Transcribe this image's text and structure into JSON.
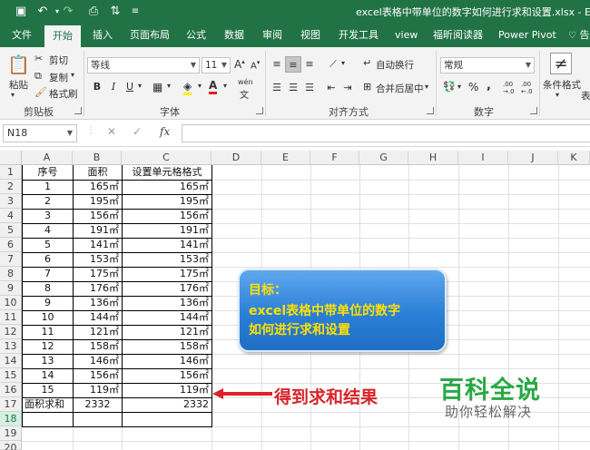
{
  "window": {
    "title": "excel表格中带单位的数字如何进行求和设置.xlsx - E",
    "qa_icons": [
      "save-icon",
      "undo-icon",
      "undo-dropdown-icon",
      "redo-icon",
      "print-preview-icon",
      "sort-icon",
      "customize-icon"
    ]
  },
  "tabs": [
    {
      "label": "文件"
    },
    {
      "label": "开始"
    },
    {
      "label": "插入"
    },
    {
      "label": "页面布局"
    },
    {
      "label": "公式"
    },
    {
      "label": "数据"
    },
    {
      "label": "审阅"
    },
    {
      "label": "视图"
    },
    {
      "label": "开发工具"
    },
    {
      "label": "view"
    },
    {
      "label": "福昕阅读器"
    },
    {
      "label": "Power Pivot"
    },
    {
      "label": "告"
    }
  ],
  "ribbon": {
    "clipboard": {
      "paste": "粘贴",
      "cut": "剪切",
      "copy": "复制",
      "format_painter": "格式刷",
      "label": "剪贴板"
    },
    "font": {
      "name": "等线",
      "size": "11",
      "bold": "B",
      "italic": "I",
      "underline": "U",
      "label": "字体",
      "grow": "A",
      "shrink": "A",
      "phonetic": "wén"
    },
    "alignment": {
      "wrap": "自动换行",
      "merge": "合并后居中",
      "label": "对齐方式"
    },
    "number": {
      "format": "常规",
      "percent": "%",
      "comma": ",",
      "label": "数字",
      "inc_dec": ".00 →.0",
      "dec_dec": ".00 ←.0"
    },
    "styles": {
      "conditional": "条件格式",
      "table": "表"
    }
  },
  "formula_bar": {
    "name_box": "N18",
    "cancel": "✕",
    "enter": "✓",
    "fx": "fx",
    "value": ""
  },
  "columns": [
    "A",
    "B",
    "C",
    "D",
    "E",
    "F",
    "G",
    "H",
    "I",
    "J",
    "K"
  ],
  "rows": [
    "1",
    "2",
    "3",
    "4",
    "5",
    "6",
    "7",
    "8",
    "9",
    "10",
    "11",
    "12",
    "13",
    "14",
    "15",
    "16",
    "17",
    "18",
    "19",
    "20"
  ],
  "table": {
    "headers": [
      "序号",
      "面积",
      "设置单元格格式"
    ],
    "data": [
      [
        "1",
        "165㎡",
        "165㎡"
      ],
      [
        "2",
        "195㎡",
        "195㎡"
      ],
      [
        "3",
        "156㎡",
        "156㎡"
      ],
      [
        "4",
        "191㎡",
        "191㎡"
      ],
      [
        "5",
        "141㎡",
        "141㎡"
      ],
      [
        "6",
        "153㎡",
        "153㎡"
      ],
      [
        "7",
        "175㎡",
        "175㎡"
      ],
      [
        "8",
        "176㎡",
        "176㎡"
      ],
      [
        "9",
        "136㎡",
        "136㎡"
      ],
      [
        "10",
        "144㎡",
        "144㎡"
      ],
      [
        "11",
        "121㎡",
        "121㎡"
      ],
      [
        "12",
        "158㎡",
        "158㎡"
      ],
      [
        "13",
        "146㎡",
        "146㎡"
      ],
      [
        "14",
        "156㎡",
        "156㎡"
      ],
      [
        "15",
        "119㎡",
        "119㎡"
      ]
    ],
    "total": [
      "面积求和",
      "2332",
      "2332"
    ]
  },
  "callout": {
    "line1": "目标：",
    "line2": "excel表格中带单位的数字",
    "line3": "如何进行求和设置"
  },
  "annotation": {
    "label": "得到求和结果",
    "color": "#d8242a"
  },
  "watermark": {
    "brand": "百科全说",
    "slogan": "助你轻松解决"
  },
  "colors": {
    "excel_green": "#217346",
    "callout_blue": "#2a7fd6",
    "callout_text": "#ffe000"
  }
}
